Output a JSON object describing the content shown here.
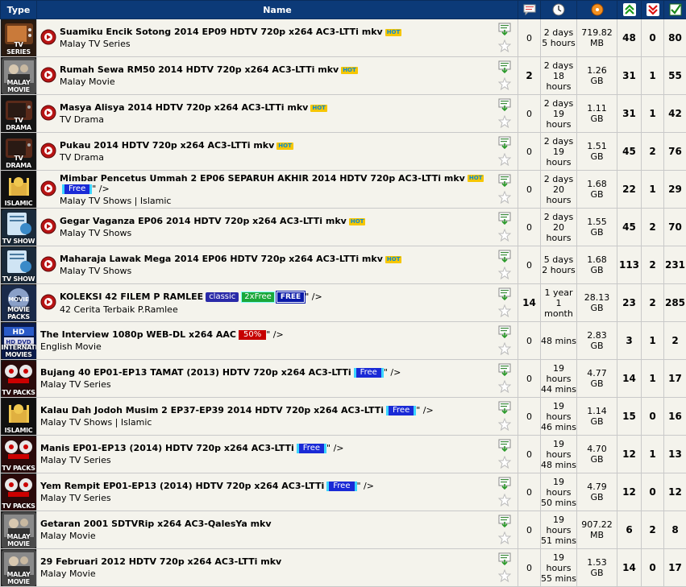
{
  "header": {
    "type_label": "Type",
    "name_label": "Name"
  },
  "icons": {
    "comments": "comments-icon",
    "time": "clock-icon",
    "size": "disc-icon",
    "seeders": "up-arrows-icon",
    "leechers": "down-arrows-icon",
    "completed": "checkmark-icon"
  },
  "rows": [
    {
      "type_label": "TV SERIES",
      "type_icon": "tv-series-icon",
      "show_play": true,
      "title": "Suamiku Encik Sotong 2014 EP09 HDTV 720p x264 AC3-LTTi mkv",
      "badges": [
        "HOT"
      ],
      "tail": "",
      "subtitle": "Malay TV Series",
      "comments": "0",
      "time1": "2 days",
      "time2": "5 hours",
      "size1": "719.82",
      "size2": "MB",
      "seeders": "48",
      "leechers": "0",
      "completed": "80"
    },
    {
      "type_label": "MALAY MOVIE",
      "type_icon": "malay-movie-icon",
      "show_play": true,
      "title": "Rumah Sewa RM50 2014 HDTV 720p x264 AC3-LTTi mkv",
      "badges": [
        "HOT"
      ],
      "tail": "",
      "subtitle": "Malay Movie",
      "comments": "2",
      "time1": "2 days",
      "time2": "18 hours",
      "size1": "1.26",
      "size2": "GB",
      "seeders": "31",
      "leechers": "1",
      "completed": "55"
    },
    {
      "type_label": "TV DRAMA",
      "type_icon": "tv-drama-icon",
      "show_play": true,
      "title": "Masya Alisya 2014 HDTV 720p x264 AC3-LTTi mkv",
      "badges": [
        "HOT"
      ],
      "tail": "",
      "subtitle": "TV Drama",
      "comments": "0",
      "time1": "2 days",
      "time2": "19 hours",
      "size1": "1.11",
      "size2": "GB",
      "seeders": "31",
      "leechers": "1",
      "completed": "42"
    },
    {
      "type_label": "TV DRAMA",
      "type_icon": "tv-drama-icon",
      "show_play": true,
      "title": "Pukau 2014 HDTV 720p x264 AC3-LTTi mkv",
      "badges": [
        "HOT"
      ],
      "tail": "",
      "subtitle": "TV Drama",
      "comments": "0",
      "time1": "2 days",
      "time2": "19 hours",
      "size1": "1.51",
      "size2": "GB",
      "seeders": "45",
      "leechers": "2",
      "completed": "76"
    },
    {
      "type_label": "ISLAMIC",
      "type_icon": "islamic-icon",
      "show_play": true,
      "title": "Mimbar Pencetus Ummah 2 EP06 SEPARUH AKHIR 2014 HDTV 720p AC3-LTTi mkv",
      "badges": [
        "HOT",
        "Free"
      ],
      "tail": "\" />",
      "subtitle": "Malay TV Shows | Islamic",
      "comments": "0",
      "time1": "2 days",
      "time2": "20 hours",
      "size1": "1.68",
      "size2": "GB",
      "seeders": "22",
      "leechers": "1",
      "completed": "29"
    },
    {
      "type_label": "TV SHOW",
      "type_icon": "tv-show-icon",
      "show_play": true,
      "title": "Gegar Vaganza EP06 2014 HDTV 720p x264 AC3-LTTi mkv",
      "badges": [
        "HOT"
      ],
      "tail": "",
      "subtitle": "Malay TV Shows",
      "comments": "0",
      "time1": "2 days",
      "time2": "20 hours",
      "size1": "1.55",
      "size2": "GB",
      "seeders": "45",
      "leechers": "2",
      "completed": "70"
    },
    {
      "type_label": "TV SHOW",
      "type_icon": "tv-show-icon",
      "show_play": true,
      "title": "Maharaja Lawak Mega 2014 EP06 HDTV 720p x264 AC3-LTTi mkv",
      "badges": [
        "HOT"
      ],
      "tail": "",
      "subtitle": "Malay TV Shows",
      "comments": "0",
      "time1": "5 days",
      "time2": "2 hours",
      "size1": "1.68",
      "size2": "GB",
      "seeders": "113",
      "leechers": "2",
      "completed": "231"
    },
    {
      "type_label": "MOVIE PACKS",
      "type_icon": "movie-packs-icon",
      "show_play": true,
      "title": "KOLEKSI 42 FILEM P RAMLEE",
      "badges": [
        "classic",
        "2xFree",
        "FREE"
      ],
      "tail": "\" />",
      "subtitle": "42 Cerita Terbaik P.Ramlee",
      "comments": "14",
      "time1": "1 year",
      "time2": "1 month",
      "size1": "28.13",
      "size2": "GB",
      "seeders": "23",
      "leechers": "2",
      "completed": "285"
    },
    {
      "type_label": "INTERNATIONAL MOVIES",
      "type_icon": "hd-dvd-icon",
      "show_play": false,
      "title": "The Interview 1080p WEB-DL x264 AAC",
      "badges": [
        "50%"
      ],
      "tail": "\" />",
      "subtitle": "English Movie",
      "comments": "0",
      "time1": "48 mins",
      "time2": "",
      "size1": "2.83",
      "size2": "GB",
      "seeders": "3",
      "leechers": "1",
      "completed": "2"
    },
    {
      "type_label": "TV PACKS",
      "type_icon": "tv-packs-icon",
      "show_play": false,
      "title": "Bujang 40 EP01-EP13 TAMAT (2013) HDTV 720p x264 AC3-LTTi",
      "badges": [
        "Free"
      ],
      "tail": "\" />",
      "subtitle": "Malay TV Series",
      "comments": "0",
      "time1": "19 hours",
      "time2": "44 mins",
      "size1": "4.77",
      "size2": "GB",
      "seeders": "14",
      "leechers": "1",
      "completed": "17"
    },
    {
      "type_label": "ISLAMIC",
      "type_icon": "islamic-icon",
      "show_play": false,
      "title": "Kalau Dah Jodoh Musim 2 EP37-EP39 2014 HDTV 720p x264 AC3-LTTi",
      "badges": [
        "Free"
      ],
      "tail": "\" />",
      "subtitle": "Malay TV Shows | Islamic",
      "comments": "0",
      "time1": "19 hours",
      "time2": "46 mins",
      "size1": "1.14",
      "size2": "GB",
      "seeders": "15",
      "leechers": "0",
      "completed": "16"
    },
    {
      "type_label": "TV PACKS",
      "type_icon": "tv-packs-icon",
      "show_play": false,
      "title": "Manis EP01-EP13 (2014) HDTV 720p x264 AC3-LTTi",
      "badges": [
        "Free"
      ],
      "tail": "\" />",
      "subtitle": "Malay TV Series",
      "comments": "0",
      "time1": "19 hours",
      "time2": "48 mins",
      "size1": "4.70",
      "size2": "GB",
      "seeders": "12",
      "leechers": "1",
      "completed": "13"
    },
    {
      "type_label": "TV PACKS",
      "type_icon": "tv-packs-icon",
      "show_play": false,
      "title": "Yem Rempit EP01-EP13 (2014) HDTV 720p x264 AC3-LTTi",
      "badges": [
        "Free"
      ],
      "tail": "\" />",
      "subtitle": "Malay TV Series",
      "comments": "0",
      "time1": "19 hours",
      "time2": "50 mins",
      "size1": "4.79",
      "size2": "GB",
      "seeders": "12",
      "leechers": "0",
      "completed": "12"
    },
    {
      "type_label": "MALAY MOVIE",
      "type_icon": "malay-movie-icon",
      "show_play": false,
      "title": "Getaran 2001 SDTVRip x264 AC3-QalesYa mkv",
      "badges": [],
      "tail": "",
      "subtitle": "Malay Movie",
      "comments": "0",
      "time1": "19 hours",
      "time2": "51 mins",
      "size1": "907.22",
      "size2": "MB",
      "seeders": "6",
      "leechers": "2",
      "completed": "8"
    },
    {
      "type_label": "MALAY MOVIE",
      "type_icon": "malay-movie-icon",
      "show_play": false,
      "title": "29 Februari 2012 HDTV 720p x264 AC3-LTTi mkv",
      "badges": [],
      "tail": "",
      "subtitle": "Malay Movie",
      "comments": "0",
      "time1": "19 hours",
      "time2": "55 mins",
      "size1": "1.53",
      "size2": "GB",
      "seeders": "14",
      "leechers": "0",
      "completed": "17"
    }
  ],
  "colors": {
    "header_bg": "#0c3a78",
    "row_bg": "#f4f3ec",
    "free_badge": "#1a2ad6",
    "hot_badge": "#f6c600",
    "discount_badge": "#c60000"
  }
}
